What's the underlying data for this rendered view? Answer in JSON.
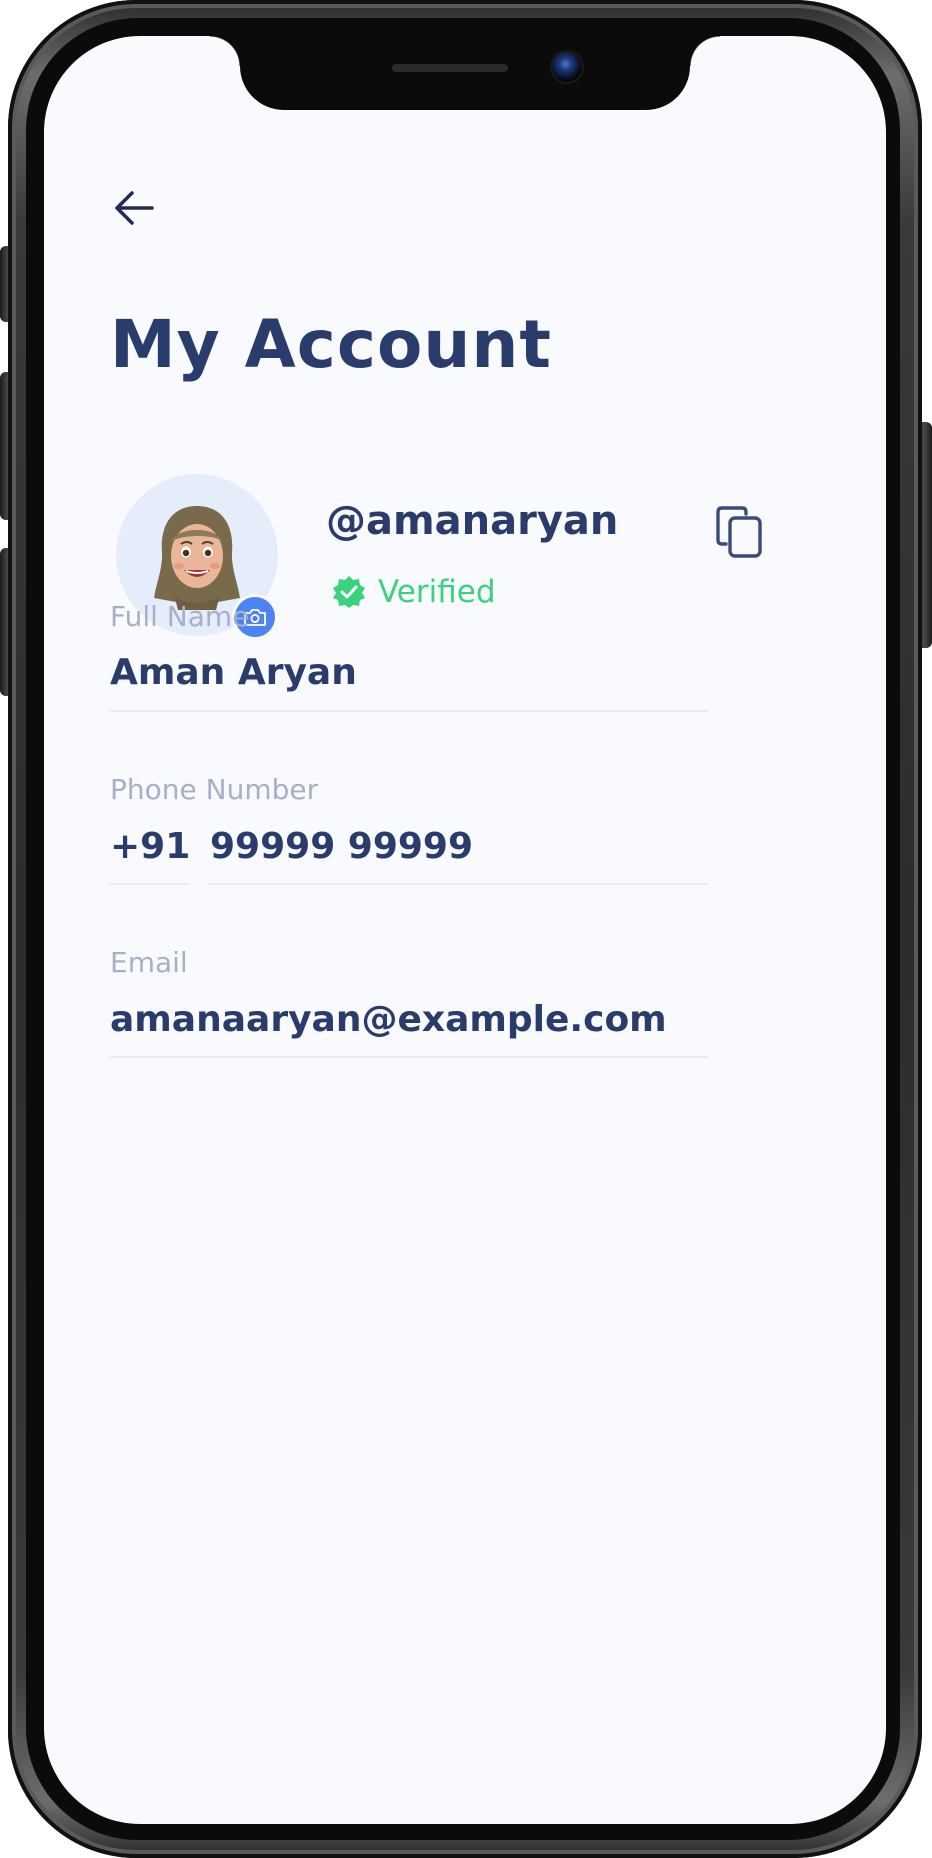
{
  "header": {
    "back_icon": "arrow-left-icon",
    "title": "My Account"
  },
  "profile": {
    "username": "@amanaryan",
    "verified_label": "Verified",
    "verified_color": "#3ad27f",
    "camera_icon": "camera-icon",
    "copy_icon": "copy-icon"
  },
  "fields": {
    "full_name": {
      "label": "Full Name",
      "value": "Aman Aryan"
    },
    "phone": {
      "label": "Phone Number",
      "country_code": "+91",
      "value": "99999 99999"
    },
    "email": {
      "label": "Email",
      "value": "amanaaryan@example.com"
    }
  },
  "colors": {
    "primary_text": "#2a3c6b",
    "label_text": "#a7b0c8",
    "accent": "#4e84f2",
    "background": "#f9fafd"
  }
}
